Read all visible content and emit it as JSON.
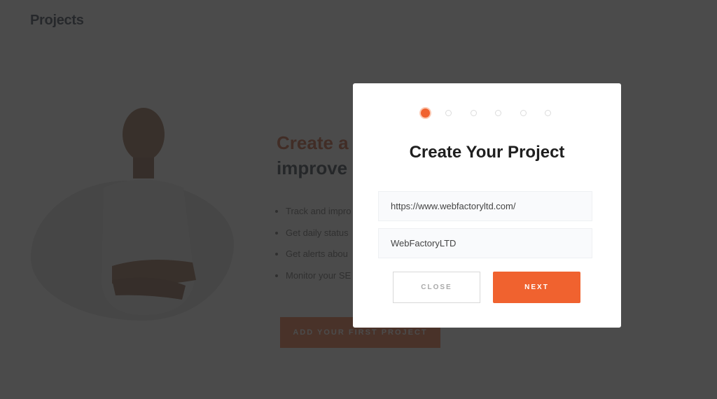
{
  "page": {
    "title": "Projects",
    "headline_accent": "Create a",
    "headline_dark": "improve",
    "features": [
      "Track and impro",
      "Get daily status",
      "Get alerts abou",
      "Monitor your SE"
    ],
    "cta_label": "ADD YOUR FIRST PROJECT"
  },
  "modal": {
    "steps_total": 6,
    "current_step": 1,
    "title": "Create Your Project",
    "url_value": "https://www.webfactoryltd.com/",
    "name_value": "WebFactoryLTD",
    "close_label": "CLOSE",
    "next_label": "NEXT"
  },
  "colors": {
    "accent": "#f0622f",
    "overlay": "#4a4a4a"
  }
}
